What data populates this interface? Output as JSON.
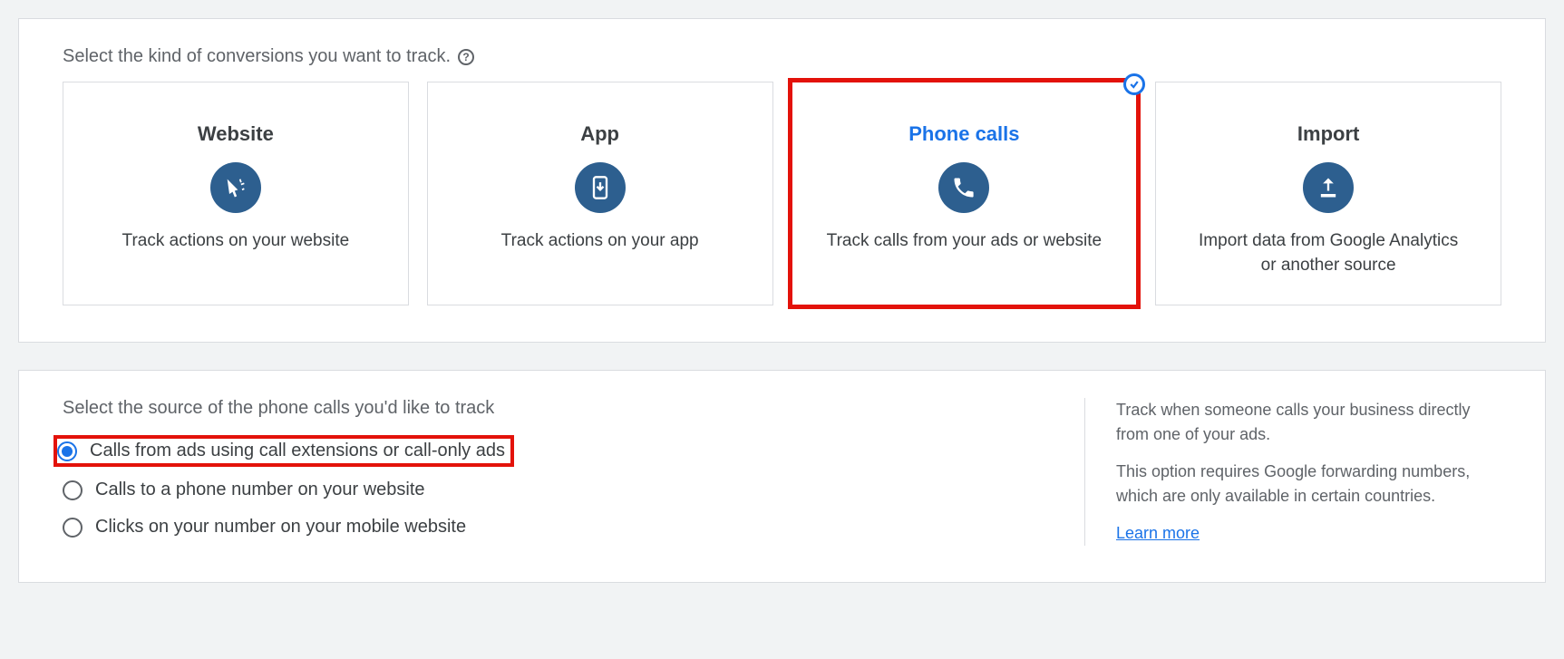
{
  "top": {
    "prompt": "Select the kind of conversions you want to track.",
    "cards": [
      {
        "title": "Website",
        "desc": "Track actions on your website",
        "selected": false
      },
      {
        "title": "App",
        "desc": "Track actions on your app",
        "selected": false
      },
      {
        "title": "Phone calls",
        "desc": "Track calls from your ads or website",
        "selected": true
      },
      {
        "title": "Import",
        "desc": "Import data from Google Analytics or another source",
        "selected": false
      }
    ]
  },
  "bottom": {
    "prompt": "Select the source of the phone calls you'd like to track",
    "options": [
      {
        "label": "Calls from ads using call extensions or call-only ads",
        "selected": true
      },
      {
        "label": "Calls to a phone number on your website",
        "selected": false
      },
      {
        "label": "Clicks on your number on your mobile website",
        "selected": false
      }
    ],
    "info": {
      "p1": "Track when someone calls your business directly from one of your ads.",
      "p2": "This option requires Google forwarding numbers, which are only available in certain countries.",
      "link": "Learn more"
    }
  }
}
